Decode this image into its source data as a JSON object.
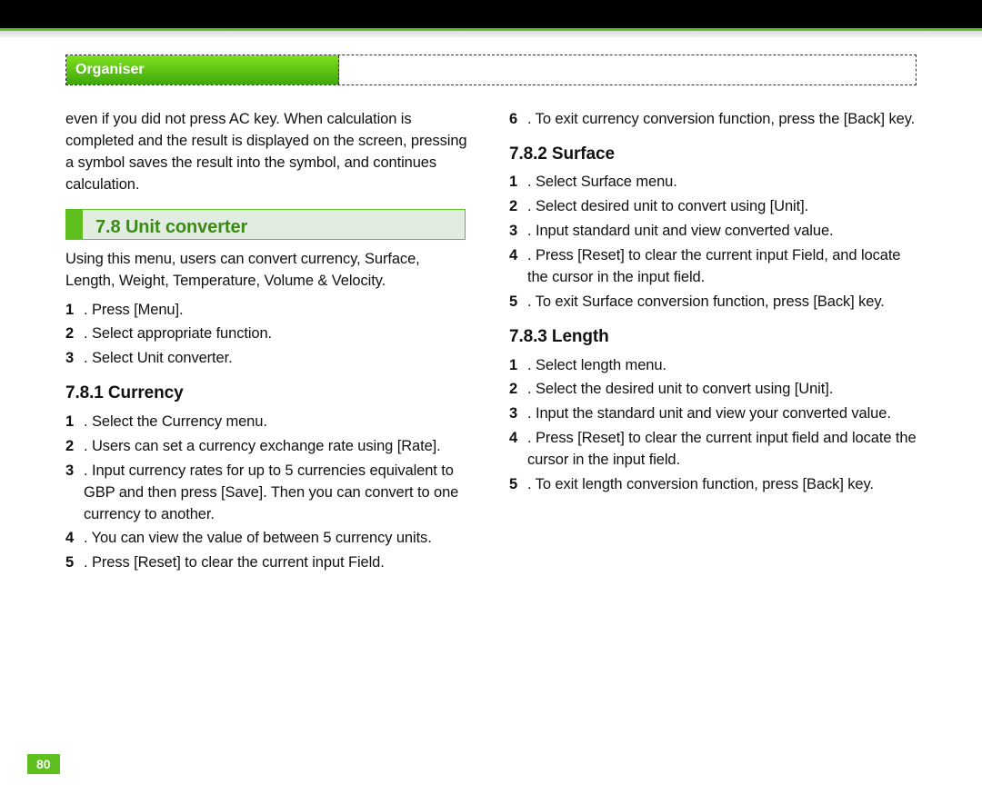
{
  "header": {
    "tab_label": "Organiser"
  },
  "page_number": "80",
  "left": {
    "intro": "even if you did not press AC key. When calculation is completed and the result is displayed on the screen, pressing a symbol saves the result into the symbol, and continues calculation.",
    "section_title": "7.8 Unit converter",
    "section_intro": "Using this menu, users can convert currency, Surface, Length, Weight, Temperature, Volume & Velocity.",
    "main_steps": [
      {
        "n": "1",
        "t": ". Press [Menu]."
      },
      {
        "n": "2",
        "t": ". Select appropriate function."
      },
      {
        "n": "3",
        "t": ". Select Unit converter."
      }
    ],
    "sub1_title": "7.8.1 Currency",
    "sub1_steps": [
      {
        "n": "1",
        "t": ". Select the Currency menu."
      },
      {
        "n": "2",
        "t": ". Users can set a currency exchange rate using [Rate]."
      },
      {
        "n": "3",
        "t": ". Input currency rates for up to 5 currencies equivalent to GBP and then press [Save]. Then you can convert to one currency to another."
      },
      {
        "n": "4",
        "t": ". You can view the value of between 5 currency units."
      },
      {
        "n": "5",
        "t": ". Press [Reset] to clear the current input Field."
      }
    ]
  },
  "right": {
    "cont_steps": [
      {
        "n": "6",
        "t": ". To exit currency conversion function, press the [Back] key."
      }
    ],
    "sub2_title": "7.8.2 Surface",
    "sub2_steps": [
      {
        "n": "1",
        "t": ". Select Surface menu."
      },
      {
        "n": "2",
        "t": ". Select desired unit to convert using [Unit]."
      },
      {
        "n": "3",
        "t": ". Input standard unit and view converted value."
      },
      {
        "n": "4",
        "t": ". Press [Reset] to clear the current input Field, and locate the cursor in the input field."
      },
      {
        "n": "5",
        "t": ". To exit Surface conversion function, press [Back] key."
      }
    ],
    "sub3_title": "7.8.3 Length",
    "sub3_steps": [
      {
        "n": "1",
        "t": ". Select length menu."
      },
      {
        "n": "2",
        "t": ". Select the desired unit to convert using [Unit]."
      },
      {
        "n": "3",
        "t": ". Input the standard unit and view your converted value."
      },
      {
        "n": "4",
        "t": ". Press [Reset] to clear the current input field and locate the cursor in the input field."
      },
      {
        "n": "5",
        "t": ". To exit length conversion function, press [Back] key."
      }
    ]
  }
}
